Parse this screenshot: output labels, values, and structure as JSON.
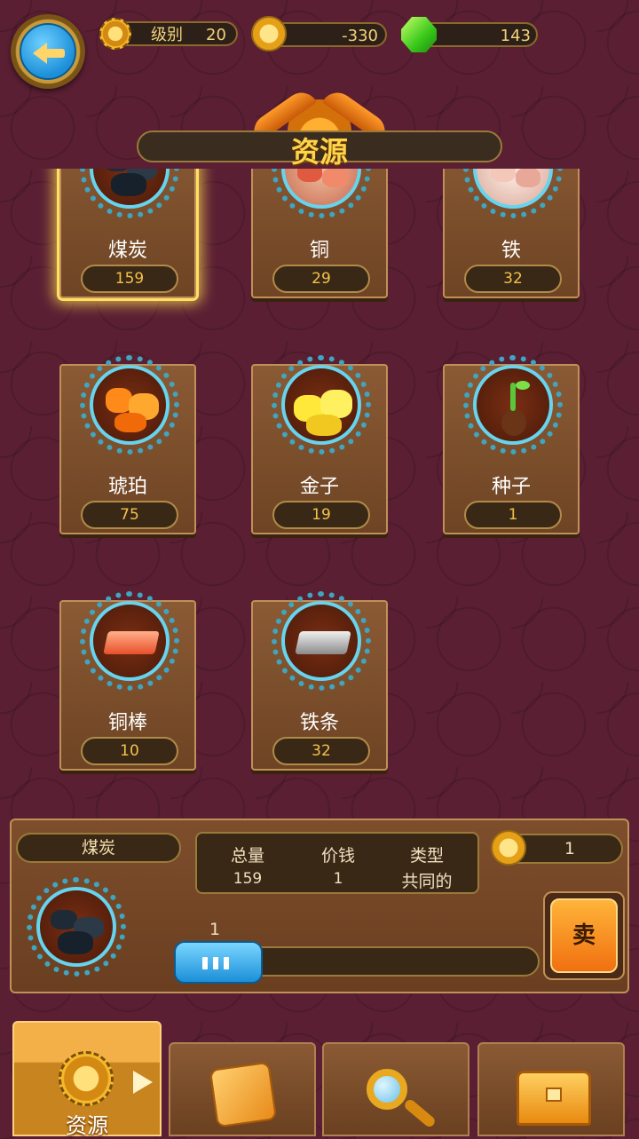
{
  "top_bar": {
    "level_label": "级别",
    "level_value": "20",
    "coins_value": "-330",
    "gems_value": "143"
  },
  "header": {
    "title": "资源"
  },
  "resources": [
    {
      "name": "煤炭",
      "count": "159",
      "icon": "coal-icon"
    },
    {
      "name": "铜",
      "count": "29",
      "icon": "copper-ore-icon"
    },
    {
      "name": "铁",
      "count": "32",
      "icon": "iron-ore-icon"
    },
    {
      "name": "琥珀",
      "count": "75",
      "icon": "amber-icon"
    },
    {
      "name": "金子",
      "count": "19",
      "icon": "gold-icon"
    },
    {
      "name": "种子",
      "count": "1",
      "icon": "seed-icon"
    },
    {
      "name": "铜棒",
      "count": "10",
      "icon": "copper-bar-icon"
    },
    {
      "name": "铁条",
      "count": "32",
      "icon": "iron-bar-icon"
    }
  ],
  "selected": {
    "name": "煤炭",
    "total_label": "总量",
    "total_value": "159",
    "price_label": "价钱",
    "price_value": "1",
    "type_label": "类型",
    "type_value": "共同的",
    "sell_price": "1",
    "quantity": "1",
    "quantity_fraction": 0.006,
    "sell_label": "卖"
  },
  "tabs": {
    "resources_label": "资源"
  },
  "colors": {
    "background": "#5a1f33",
    "accent_gold": "#ffd44a",
    "panel_brown": "#7e4e2c",
    "slider_blue": "#1c8fd8"
  }
}
